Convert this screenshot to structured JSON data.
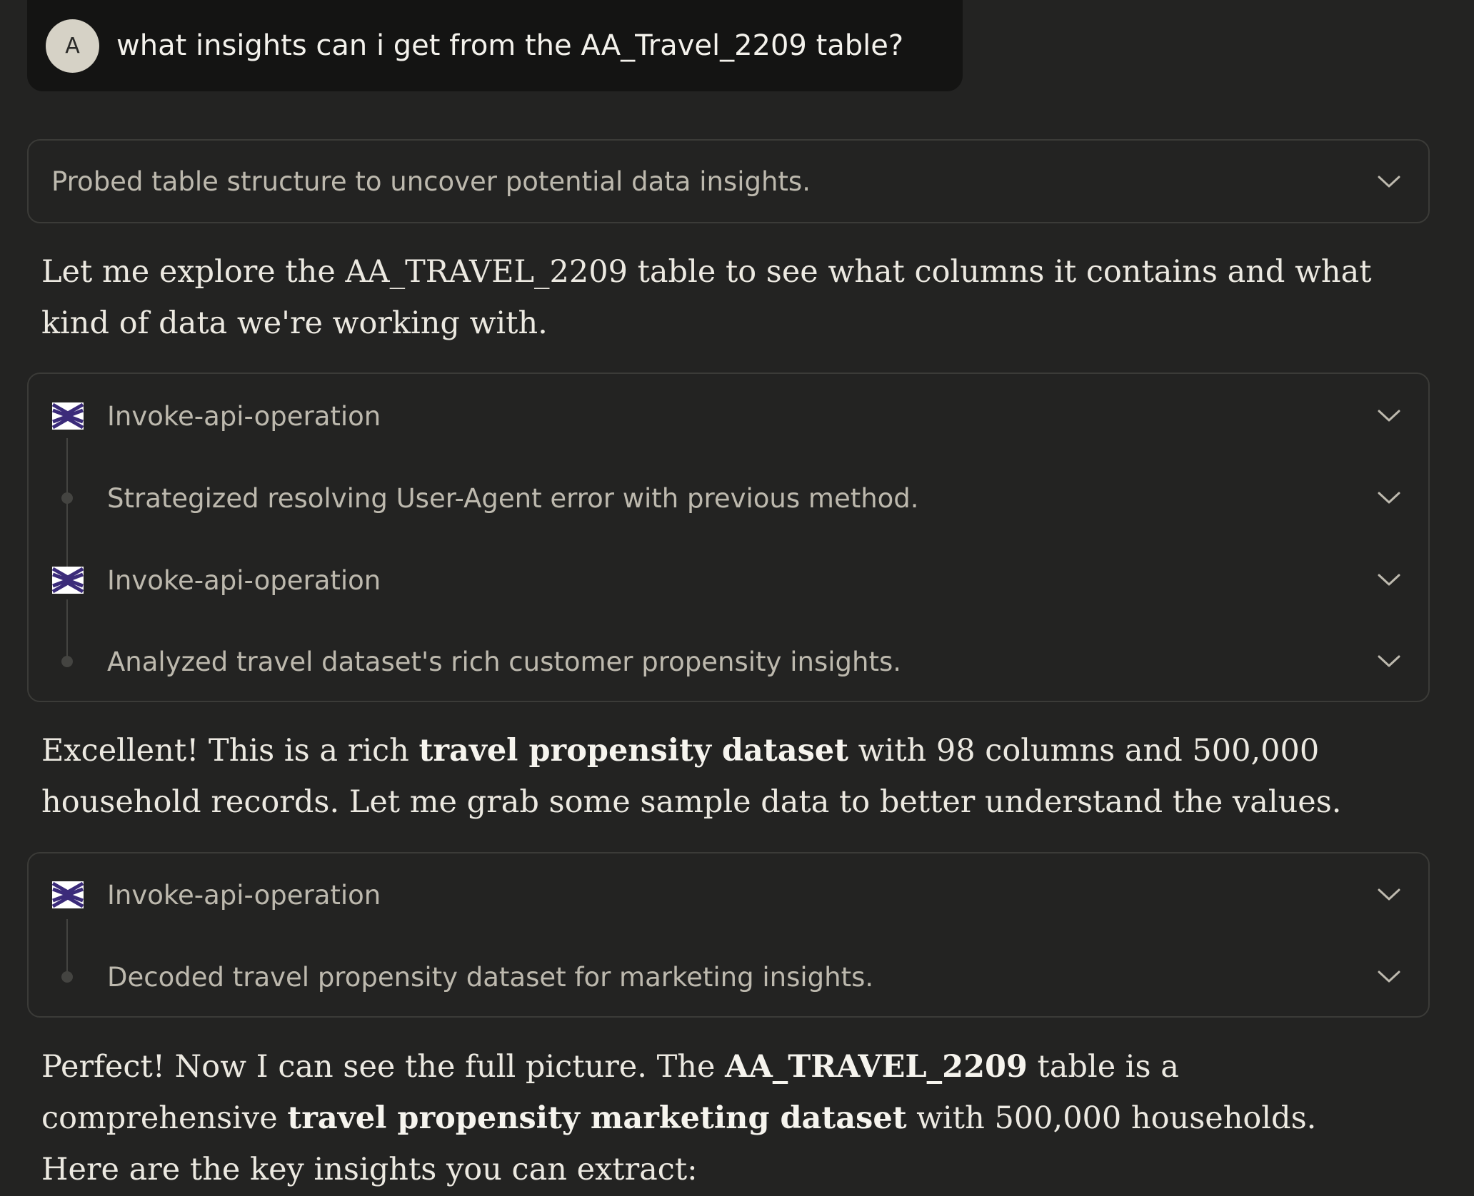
{
  "user": {
    "avatar_initial": "A",
    "message": "what insights can i get from the AA_Travel_2209 table?"
  },
  "thought": {
    "text": "Probed table structure to uncover potential data insights."
  },
  "para1": {
    "text": "Let me explore the AA_TRAVEL_2209 table to see what columns it contains and what kind of data we're working with."
  },
  "steps_group_1": {
    "items": [
      {
        "kind": "tool",
        "label": "Invoke-api-operation"
      },
      {
        "kind": "thought",
        "label": "Strategized resolving User-Agent error with previous method."
      },
      {
        "kind": "tool",
        "label": "Invoke-api-operation"
      },
      {
        "kind": "thought",
        "label": "Analyzed travel dataset's rich customer propensity insights."
      }
    ]
  },
  "para2": {
    "part1": "Excellent! This is a rich ",
    "bold1": "travel propensity dataset",
    "part2": " with 98 columns and 500,000 household records. Let me grab some sample data to better understand the values."
  },
  "steps_group_2": {
    "items": [
      {
        "kind": "tool",
        "label": "Invoke-api-operation"
      },
      {
        "kind": "thought",
        "label": "Decoded travel propensity dataset for marketing insights."
      }
    ]
  },
  "para3": {
    "part1": "Perfect! Now I can see the full picture. The ",
    "bold1": "AA_TRAVEL_2209",
    "part2": " table is a comprehensive ",
    "bold2": "travel propensity marketing dataset",
    "part3": " with 500,000 households. Here are the key insights you can extract:"
  },
  "icons": {
    "expand": "chevron-down-icon",
    "tool": "api-connector-icon"
  },
  "colors": {
    "background": "#232322",
    "user_bubble": "#141413",
    "border": "#3b3b38",
    "muted_text": "#bdb9ae",
    "tool_icon": "#3b2b7a"
  }
}
